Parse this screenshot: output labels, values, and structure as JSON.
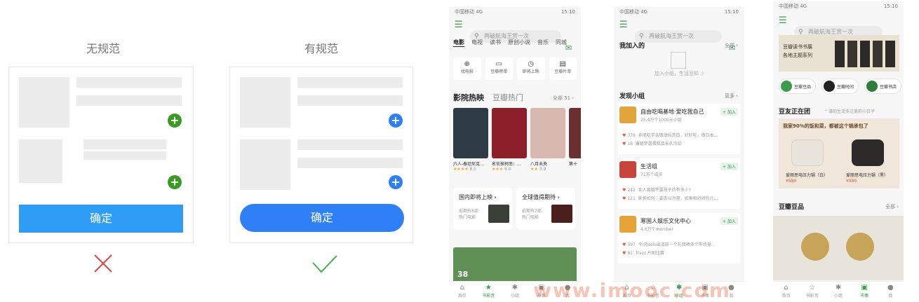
{
  "comparison": {
    "bad_title": "无规范",
    "good_title": "有规范",
    "confirm_label": "确定",
    "plus_symbol": "+",
    "bad_mark": "✕",
    "good_mark": "✓",
    "colors": {
      "plus_bad": "#3a9b23",
      "plus_good": "#2f7ff7",
      "btn_bad": "#2f9cf5",
      "btn_good": "#2f7ff7",
      "cross": "#e0483e",
      "check": "#4caf50"
    }
  },
  "phone1": {
    "status_left": "中国移动 4G",
    "status_right": "15:10",
    "search_placeholder": "再破航海王赏一次",
    "badge": "1",
    "tabs": [
      "电影",
      "电视",
      "读书",
      "原创小说",
      "音乐",
      "同城"
    ],
    "quick": [
      "找电影",
      "豆瓣榜单",
      "即将上映",
      "豆瓣片单"
    ],
    "section_title": "影院热映",
    "section_alt": "豆瓣热门",
    "section_more": "全部 51",
    "movies": [
      {
        "title": "六人-泰坦尼克...",
        "rating": "8.5",
        "color": "#2e3a44"
      },
      {
        "title": "名侦探柯南：...",
        "rating": "6.0",
        "color": "#8c1f2a"
      },
      {
        "title": "八月未央",
        "rating": "3.9",
        "color": "#d8b9b0"
      },
      {
        "title": "第十",
        "rating": "",
        "color": "#6a2f30"
      }
    ],
    "card1_title": "国内即将上映",
    "card1_sub1": "近期有8部",
    "card1_sub2": "热门电影",
    "card2_title": "全球值得期待",
    "card2_sub1": "近期有7部",
    "card2_sub2": "热门电影",
    "banner_text": "38",
    "tabbar": [
      "首页",
      "书影音",
      "小组",
      "市集",
      "我"
    ]
  },
  "phone2": {
    "status_left": "中国移动 4G",
    "status_right": "15:10",
    "search_placeholder": "再破航海王赏一次",
    "badge": "1",
    "joined_title": "我加入的",
    "joined_more": "全部",
    "joined_empty": "加入小组，生活豆知 :)",
    "discover_title": "发现小组",
    "discover_more": "更多",
    "join_label": "+ 加入",
    "groups": [
      {
        "name": "自由吃喝基地·爱吃我自己",
        "meta": "25.4万个1000元小组",
        "p1c": "379",
        "p1": "手把吃学会做油焖茭白，好好吃，做日本...",
        "p2c": "18",
        "p2": "康姐梦露蛋糕会长久冷却",
        "color": "#e2a53c"
      },
      {
        "name": "生活组",
        "meta": "71万个成员",
        "p1c": "242",
        "p1": "女人离婚不要孩子的有多少?",
        "p2c": "121",
        "p2": "家长如何｜姿态以为豪，如果相对对你儿...",
        "color": "#c9443a"
      },
      {
        "name": "寒国人娱乐文化中心",
        "meta": "4.0万个member",
        "p1c": "397",
        "p1": "今/月solo出道前一个礼拜晒多个市场身...",
        "p2c": "81",
        "p2": "Trazz 片剧比赛",
        "color": "#e8a338"
      }
    ],
    "tabbar": [
      "首页",
      "书影音",
      "小组",
      "市集",
      "我"
    ]
  },
  "phone3": {
    "status_left": "中国移动 4G",
    "status_right": "15:10",
    "search_placeholder": "再破航海王赏一次",
    "badge": "1",
    "banner_l1": "豆瓣读书书展",
    "banner_l2": "各地主题系列",
    "pills": [
      "豆瓣豆品",
      "豆瓣时间",
      "豆瓣书店"
    ],
    "group_title": "豆友正在团",
    "group_sub": "谁的生活多过美的小日子",
    "promo_title": "我家90%的饭和菜，都被这个锅承包了",
    "products": [
      {
        "name": "爱丽思电压力锅（白）",
        "price": "¥580"
      },
      {
        "name": "爱丽思电压力锅（黑）",
        "price": "¥580"
      }
    ],
    "goods_title": "豆瓣豆品",
    "goods_more": "全部",
    "tabbar": [
      "首页",
      "书影音",
      "小组",
      "市集",
      "我"
    ]
  },
  "watermark": "www.imooc.com"
}
